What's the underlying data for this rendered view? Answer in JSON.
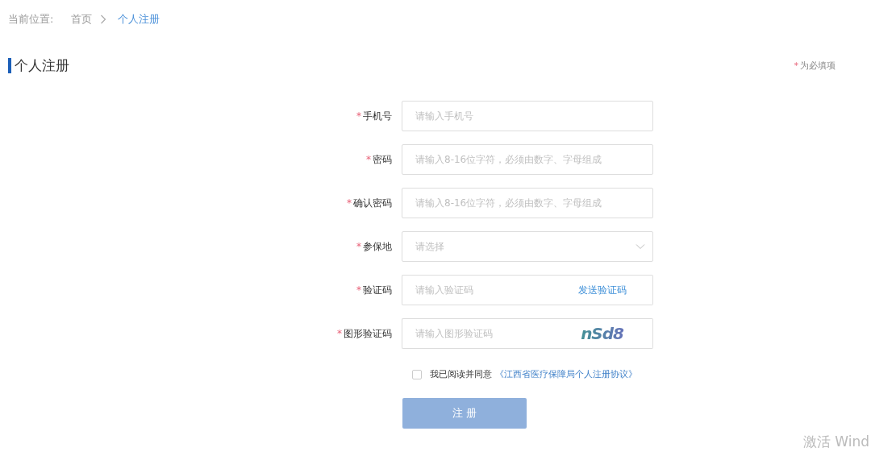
{
  "breadcrumb": {
    "label": "当前位置:",
    "items": [
      {
        "text": "首页",
        "selected": false
      },
      {
        "text": "个人注册",
        "selected": true
      }
    ]
  },
  "page_title": "个人注册",
  "required_note": {
    "mark": "*",
    "text": "为必填项"
  },
  "fields": [
    {
      "kind": "text",
      "label": "手机号",
      "required": true,
      "placeholder": "请输入手机号"
    },
    {
      "kind": "text",
      "label": "密码",
      "required": true,
      "placeholder": "请输入8-16位字符，必须由数字、字母组成"
    },
    {
      "kind": "text",
      "label": "确认密码",
      "required": true,
      "placeholder": "请输入8-16位字符，必须由数字、字母组成"
    },
    {
      "kind": "select",
      "label": "参保地",
      "required": true,
      "placeholder": "请选择"
    },
    {
      "kind": "sms",
      "label": "验证码",
      "required": true,
      "placeholder": "请输入验证码",
      "action": "发送验证码"
    },
    {
      "kind": "captcha",
      "label": "图形验证码",
      "required": true,
      "placeholder": "请输入图形验证码",
      "captcha": "nSd8"
    }
  ],
  "agreement": {
    "checked": false,
    "text": "我已阅读并同意",
    "link": "《江西省医疗保障局个人注册协议》"
  },
  "submit": {
    "label": "注 册",
    "disabled": true
  },
  "os_notice": "激活 Wind"
}
